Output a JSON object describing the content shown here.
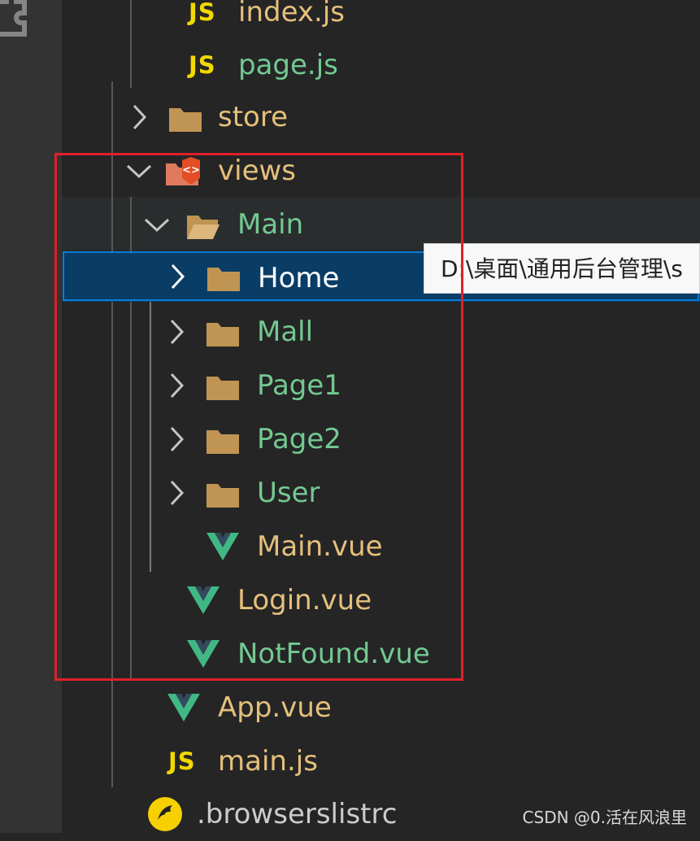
{
  "tree": {
    "items": [
      {
        "label": "index.js",
        "icon": "js-icon",
        "color": "#e5c07b"
      },
      {
        "label": "page.js",
        "icon": "js-icon",
        "color": "#73c991"
      },
      {
        "label": "store",
        "icon": "folder-icon",
        "color": "#e5c07b",
        "expanded": false
      },
      {
        "label": "views",
        "icon": "views-folder-icon",
        "color": "#e5c07b",
        "expanded": true
      },
      {
        "label": "Main",
        "icon": "folder-open-icon",
        "color": "#73c991",
        "expanded": true
      },
      {
        "label": "Home",
        "icon": "folder-icon",
        "color": "#ffffff",
        "expanded": false,
        "selected": true
      },
      {
        "label": "Mall",
        "icon": "folder-icon",
        "color": "#73c991",
        "expanded": false
      },
      {
        "label": "Page1",
        "icon": "folder-icon",
        "color": "#73c991",
        "expanded": false
      },
      {
        "label": "Page2",
        "icon": "folder-icon",
        "color": "#73c991",
        "expanded": false
      },
      {
        "label": "User",
        "icon": "folder-icon",
        "color": "#73c991",
        "expanded": false
      },
      {
        "label": "Main.vue",
        "icon": "vue-icon",
        "color": "#e5c07b"
      },
      {
        "label": "Login.vue",
        "icon": "vue-icon",
        "color": "#e5c07b"
      },
      {
        "label": "NotFound.vue",
        "icon": "vue-icon",
        "color": "#73c991"
      },
      {
        "label": "App.vue",
        "icon": "vue-icon",
        "color": "#e5c07b"
      },
      {
        "label": "main.js",
        "icon": "js-icon",
        "color": "#e5c07b"
      },
      {
        "label": ".browserslistrc",
        "icon": "browserslist-icon",
        "color": "#cccccc"
      }
    ],
    "js_badge": "JS"
  },
  "tooltip": {
    "text": "D:\\桌面\\通用后台管理\\s"
  },
  "watermark": "CSDN @0.活在风浪里",
  "colors": {
    "sidebar": "#252526",
    "activity_bar": "#333333",
    "selection": "#0a3d66",
    "selection_border": "#0a7dd8",
    "annotation": "#e0202a",
    "folder": "#c09553",
    "vue": "#41b883"
  }
}
